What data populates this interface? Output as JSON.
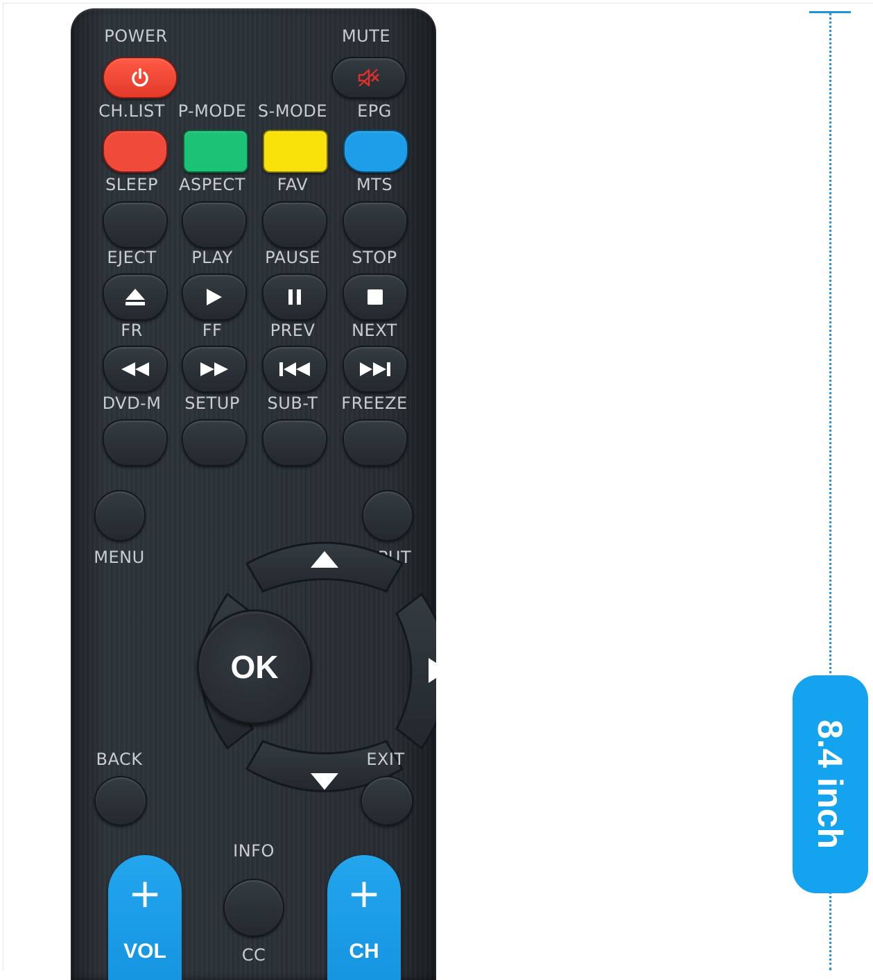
{
  "remote": {
    "top_labels": {
      "power": "POWER",
      "mute": "MUTE"
    },
    "color_row": {
      "labels": [
        "CH.LIST",
        "P-MODE",
        "S-MODE",
        "EPG"
      ],
      "colors": [
        "#f04a3a",
        "#1cc377",
        "#f8e20a",
        "#1e9ee8"
      ]
    },
    "row_sleep": [
      "SLEEP",
      "ASPECT",
      "FAV",
      "MTS"
    ],
    "row_media1": [
      "EJECT",
      "PLAY",
      "PAUSE",
      "STOP"
    ],
    "row_media2": [
      "FR",
      "FF",
      "PREV",
      "NEXT"
    ],
    "row_misc": [
      "DVD-M",
      "SETUP",
      "SUB-T",
      "FREEZE"
    ],
    "nav": {
      "menu": "MENU",
      "input": "INPUT",
      "ok": "OK",
      "back": "BACK",
      "exit": "EXIT"
    },
    "bottom": {
      "info": "INFO",
      "cc": "CC",
      "vol": "VOL",
      "ch": "CH",
      "plus": "+"
    },
    "power_color": "#f04a3a",
    "mute_icon_color": "#e0302a",
    "body_color": "#2a3137",
    "accent_blue": "#1f9ae6"
  },
  "dimension": {
    "text": "8.4 inch",
    "color": "#1f93dc"
  }
}
